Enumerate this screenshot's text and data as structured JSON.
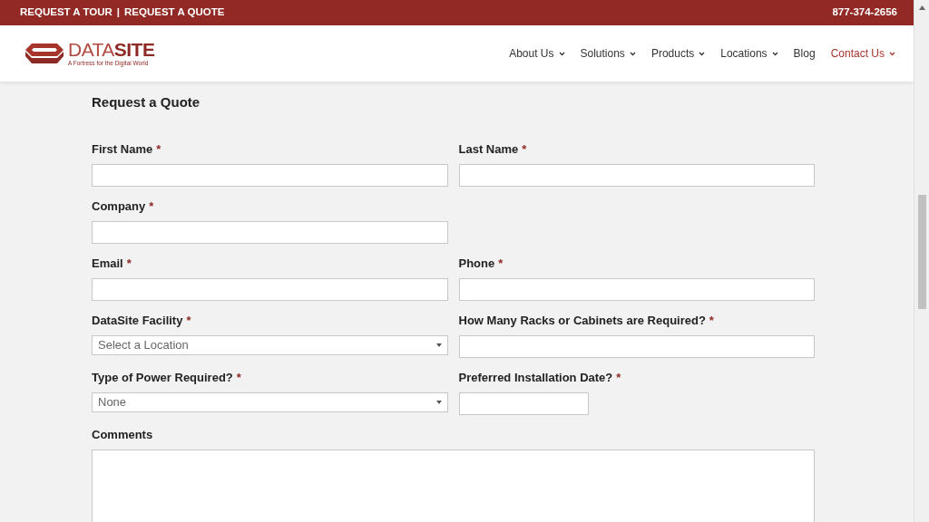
{
  "top_bar": {
    "links": [
      "REQUEST A TOUR",
      "REQUEST A QUOTE"
    ],
    "separator": "|",
    "phone": "877-374-2656"
  },
  "logo": {
    "word_light": "DATA",
    "word_bold": "SITE",
    "tagline": "A Fortress for the Digital World"
  },
  "nav": [
    {
      "label": "About Us",
      "dropdown": true,
      "selected": false
    },
    {
      "label": "Solutions",
      "dropdown": true,
      "selected": false
    },
    {
      "label": "Products",
      "dropdown": true,
      "selected": false
    },
    {
      "label": "Locations",
      "dropdown": true,
      "selected": false
    },
    {
      "label": "Blog",
      "dropdown": false,
      "selected": false
    },
    {
      "label": "Contact Us",
      "dropdown": true,
      "selected": true
    }
  ],
  "form": {
    "title": "Request a Quote",
    "required_mark": "*",
    "rows": [
      [
        {
          "label": "First Name",
          "required": true,
          "kind": "text"
        },
        {
          "label": "Last Name",
          "required": true,
          "kind": "text"
        }
      ],
      [
        {
          "label": "Company",
          "required": true,
          "kind": "text"
        }
      ],
      [
        {
          "label": "Email",
          "required": true,
          "kind": "text"
        },
        {
          "label": "Phone",
          "required": true,
          "kind": "text"
        }
      ],
      [
        {
          "label": "DataSite Facility",
          "required": true,
          "kind": "select",
          "value": "Select a Location"
        },
        {
          "label": "How Many Racks or Cabinets are Required?",
          "required": true,
          "kind": "text"
        }
      ],
      [
        {
          "label": "Type of Power Required?",
          "required": true,
          "kind": "select",
          "value": "None"
        },
        {
          "label": "Preferred Installation Date?",
          "required": true,
          "kind": "date"
        }
      ],
      [
        {
          "label": "Comments",
          "required": false,
          "kind": "textarea"
        }
      ]
    ]
  }
}
